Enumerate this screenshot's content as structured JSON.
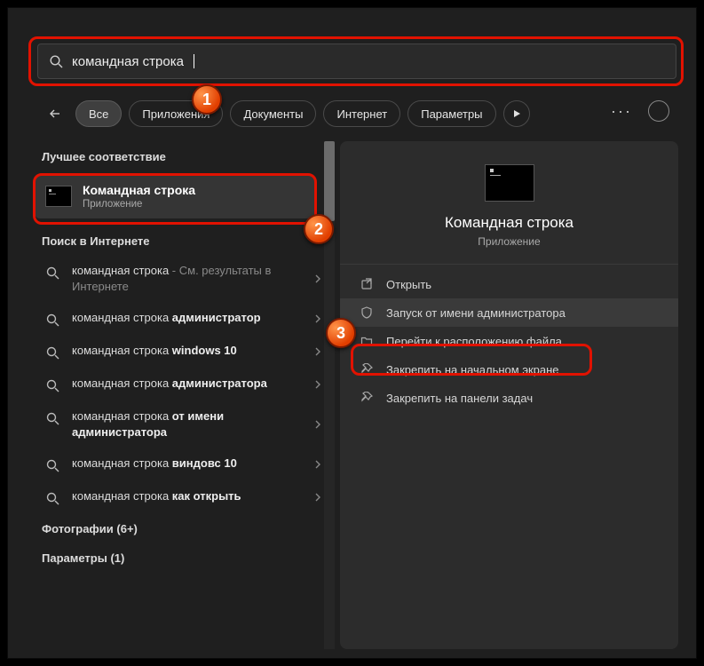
{
  "search": {
    "query": "командная строка"
  },
  "filters": {
    "back_aria": "Назад",
    "items": [
      "Все",
      "Приложения",
      "Документы",
      "Интернет",
      "Параметры"
    ],
    "active_index": 0,
    "play_aria": "Далее"
  },
  "sections": {
    "best_match": "Лучшее соответствие",
    "web_search": "Поиск в Интернете",
    "photos": "Фотографии (6+)",
    "settings": "Параметры (1)"
  },
  "best_match_item": {
    "title": "Командная строка",
    "subtitle": "Приложение"
  },
  "web_items": [
    {
      "prefix": "командная строка",
      "suffix": " - См. результаты в Интернете",
      "bold": "",
      "dim_suffix": true
    },
    {
      "prefix": "командная строка ",
      "suffix": "",
      "bold": "администратор"
    },
    {
      "prefix": "командная строка ",
      "suffix": "",
      "bold": "windows 10"
    },
    {
      "prefix": "командная строка ",
      "suffix": "",
      "bold": "администратора"
    },
    {
      "prefix": "командная строка ",
      "suffix": "",
      "bold": "от имени администратора"
    },
    {
      "prefix": "командная строка ",
      "suffix": "",
      "bold": "виндовс 10"
    },
    {
      "prefix": "командная строка ",
      "suffix": "",
      "bold": "как открыть"
    }
  ],
  "preview": {
    "title": "Командная строка",
    "subtitle": "Приложение"
  },
  "actions": [
    {
      "icon": "open-icon",
      "label": "Открыть"
    },
    {
      "icon": "shield-icon",
      "label": "Запуск от имени администратора"
    },
    {
      "icon": "folder-icon",
      "label": "Перейти к расположению файла"
    },
    {
      "icon": "pin-icon",
      "label": "Закрепить на начальном экране"
    },
    {
      "icon": "pin-icon",
      "label": "Закрепить на панели задач"
    }
  ],
  "annotations": {
    "n1": "1",
    "n2": "2",
    "n3": "3"
  }
}
